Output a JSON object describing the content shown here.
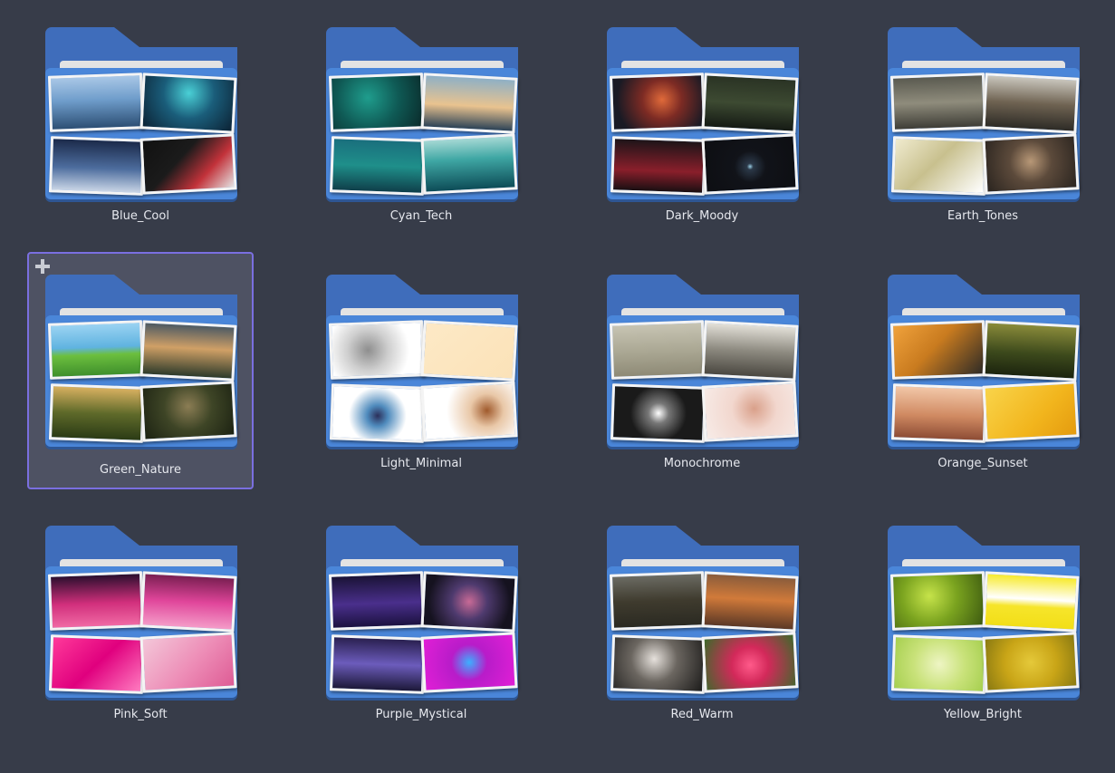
{
  "folders": [
    {
      "name": "Blue_Cool",
      "selected": false,
      "thumbs": [
        "linear-gradient(180deg,#a9c7e6 0%,#6f9dcb 45%,#2d4f74 100%)",
        "radial-gradient(circle at 50% 30%,#4ad0d6 0%,#1a5d7a 45%,#0c2234 100%)",
        "linear-gradient(180deg,#1b2a4a 0%,#4d6d9e 55%,#c9d5e6 100%)",
        "linear-gradient(135deg,#111 0%,#1b1b1b 40%,#c2323a 70%,#e4e4e4 100%)"
      ]
    },
    {
      "name": "Cyan_Tech",
      "selected": false,
      "thumbs": [
        "radial-gradient(circle at 40% 40%,#1f9d8d 0%,#0f5a55 50%,#0a2a2a 100%)",
        "linear-gradient(180deg,#8fb0c5 0%,#e9c38f 55%,#2b4256 100%)",
        "linear-gradient(180deg,#1a6f7d 0%,#1f8f8a 50%,#0f3f4a 100%)",
        "linear-gradient(180deg,#a5d8d4 0%,#3fa7a4 40%,#0d4c57 100%)"
      ]
    },
    {
      "name": "Dark_Moody",
      "selected": false,
      "thumbs": [
        "radial-gradient(circle at 55% 45%,#e06a3a 0%,#7d2b24 35%,#1a1a24 80%)",
        "linear-gradient(180deg,#2a3324 0%,#3d4a32 50%,#151a14 100%)",
        "linear-gradient(180deg,#1d1418 0%,#8a1f2b 60%,#1a0f12 100%)",
        "radial-gradient(circle at 50% 55%,#9bd0e6 0%,#2b3848 6%,#111319 30%,#0d0e12 100%)"
      ]
    },
    {
      "name": "Earth_Tones",
      "selected": false,
      "thumbs": [
        "linear-gradient(180deg,#5a5a50 0%,#8f8c7c 50%,#3e3d36 100%)",
        "linear-gradient(180deg,#c9c6bd 0%,#6f6352 50%,#2d2b26 100%)",
        "linear-gradient(135deg,#f0ebcf 0%,#c8c08e 45%,#ffffff 100%)",
        "radial-gradient(circle at 50% 45%,#b89877 0%,#5c4a3b 40%,#2a241f 100%)"
      ]
    },
    {
      "name": "Green_Nature",
      "selected": true,
      "thumbs": [
        "linear-gradient(180deg,#9bd3f2 0%,#5fb3e0 45%,#6cbf3e 60%,#3f8f2c 100%)",
        "linear-gradient(180deg,#4d5a63 0%,#d0a066 45%,#2d3a2a 100%)",
        "linear-gradient(180deg,#d8b060 0%,#5f6a2a 50%,#2b3b15 100%)",
        "radial-gradient(circle at 50% 40%,#8b7d54 0%,#3e4526 45%,#1c2212 100%)"
      ]
    },
    {
      "name": "Light_Minimal",
      "selected": false,
      "thumbs": [
        "radial-gradient(circle at 40% 50%,#8e8e8e 0%,#cfcfcf 35%,#ffffff 70%)",
        "linear-gradient(135deg,#fde9c6 0%,#fbe2b8 100%)",
        "radial-gradient(circle at 50% 55%,#2b2f5a 0%,#4f8bbd 20%,#ffffff 55%)",
        "radial-gradient(circle at 70% 50%,#a05a2c 0%,#e9c8a8 25%,#ffffff 60%)"
      ]
    },
    {
      "name": "Monochrome",
      "selected": false,
      "thumbs": [
        "linear-gradient(180deg,#c7c4b3 0%,#a9a692 55%,#8e8a76 100%)",
        "linear-gradient(180deg,#e3e0d8 0%,#8d8a80 50%,#4a4740 100%)",
        "radial-gradient(circle at 50% 50%,#ffffff 0%,#777 20%,#1a1a1a 55%)",
        "radial-gradient(circle at 55% 45%,#d9a08a 0%,#f2d7ce 40%,#f7ece8 100%)"
      ]
    },
    {
      "name": "Orange_Sunset",
      "selected": false,
      "thumbs": [
        "linear-gradient(135deg,#f0a23c 0%,#c97b1f 45%,#2d2a26 100%)",
        "linear-gradient(180deg,#8a8b3a 0%,#3d4a1c 55%,#1c240e 100%)",
        "linear-gradient(180deg,#f2c7a8 0%,#d08a62 55%,#8d4c35 100%)",
        "linear-gradient(135deg,#f9d44a 0%,#f2b51d 60%,#e49b0f 100%)"
      ]
    },
    {
      "name": "Pink_Soft",
      "selected": false,
      "thumbs": [
        "linear-gradient(180deg,#2b0f2e 0%,#d12f7c 55%,#f06aa4 100%)",
        "linear-gradient(180deg,#7a1f52 0%,#e0459a 50%,#f49cc8 100%)",
        "linear-gradient(135deg,#ff3a9a 0%,#e0007e 50%,#ff7cc0 100%)",
        "linear-gradient(135deg,#f3c7d9 0%,#ed8cb6 55%,#de5c95 100%)"
      ]
    },
    {
      "name": "Purple_Mystical",
      "selected": false,
      "thumbs": [
        "linear-gradient(180deg,#1a1336 0%,#4a2f8c 55%,#1c1240 100%)",
        "radial-gradient(circle at 50% 50%,#c86a96 0%,#4e3a6e 35%,#15121f 80%)",
        "linear-gradient(180deg,#2a2050 0%,#6c5cbc 50%,#1c1838 100%)",
        "radial-gradient(circle at 50% 50%,#3bb0ff 0%,#b81cc9 35%,#e11fd6 100%)"
      ]
    },
    {
      "name": "Red_Warm",
      "selected": false,
      "thumbs": [
        "linear-gradient(180deg,#6b6b63 0%,#3f3b2e 50%,#2b2a22 100%)",
        "linear-gradient(180deg,#8a5c3b 0%,#d17a3a 45%,#5b3826 100%)",
        "radial-gradient(circle at 45% 40%,#e6e1dc 0%,#6b6660 40%,#1c1b1a 100%)",
        "radial-gradient(circle at 50% 55%,#ff5a8a 0%,#d3295a 35%,#3c6a2a 100%)"
      ]
    },
    {
      "name": "Yellow_Bright",
      "selected": false,
      "thumbs": [
        "radial-gradient(circle at 40% 40%,#c6e34a 0%,#7aa31f 45%,#3d5a10 100%)",
        "linear-gradient(180deg,#f7ea2d 0%,#ffffff 45%,#f6e52a 60%,#f2de18 100%)",
        "radial-gradient(circle at 50% 50%,#eef5c4 0%,#c9e27a 50%,#a6cf4f 100%)",
        "radial-gradient(circle at 50% 50%,#e5c93a 0%,#c9a517 50%,#8a7a12 100%)"
      ]
    }
  ]
}
